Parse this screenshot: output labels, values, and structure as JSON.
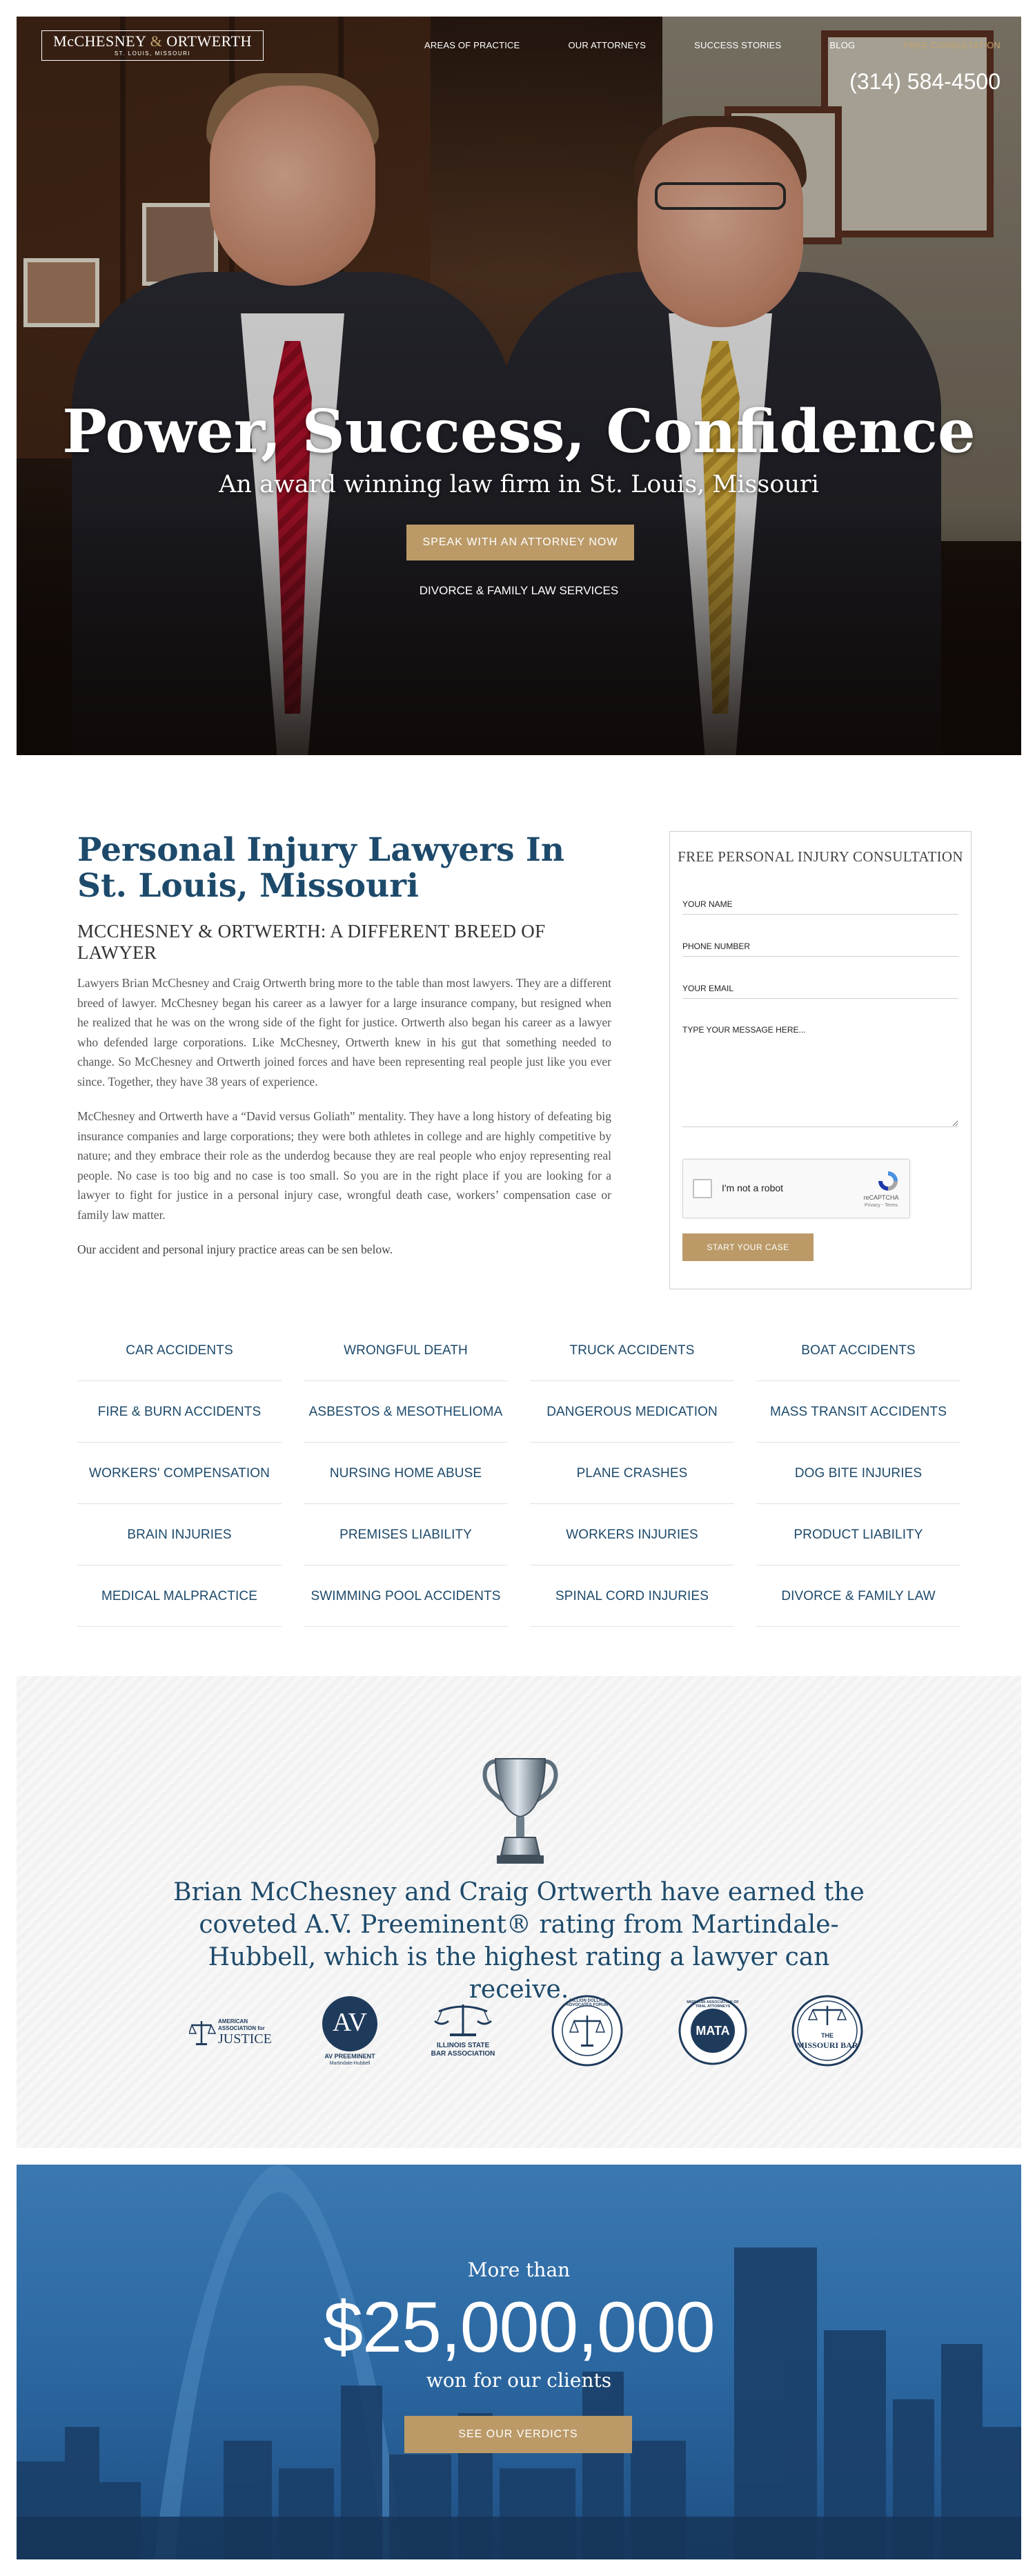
{
  "brand": {
    "logo_name_a": "McCHESNEY",
    "logo_amp": "&",
    "logo_name_b": "ORTWERTH",
    "logo_location": "ST. LOUIS, MISSOURI",
    "accent_color": "#bb9a68",
    "primary_color": "#1d4a6b"
  },
  "nav": {
    "items": [
      {
        "label": "AREAS OF PRACTICE"
      },
      {
        "label": "OUR ATTORNEYS"
      },
      {
        "label": "SUCCESS STORIES"
      },
      {
        "label": "BLOG"
      },
      {
        "label": "FREE CONSULTATION"
      }
    ],
    "phone": "(314) 584-4500"
  },
  "hero": {
    "title": "Power, Success, Confidence",
    "subtitle": "An award winning law firm in St. Louis, Missouri",
    "cta_label": "SPEAK WITH AN ATTORNEY NOW",
    "link_label": "DIVORCE & FAMILY LAW SERVICES"
  },
  "intro": {
    "heading": "Personal Injury Lawyers In St. Louis, Missouri",
    "subheading": "MCCHESNEY & ORTWERTH: A DIFFERENT BREED OF LAWYER",
    "paragraph_1": "Lawyers Brian McChesney and Craig Ortwerth bring more to the table than most lawyers. They are a different breed of lawyer. McChesney began his career as a lawyer for a large insurance company, but resigned when he realized that he was on the wrong side of the fight for justice. Ortwerth also began his career as a lawyer who defended large corporations. Like McChesney, Ortwerth knew in his gut that something needed to change. So McChesney and Ortwerth joined forces and have been representing real people just like you ever since. Together, they have 38 years of experience.",
    "paragraph_2": "McChesney and Ortwerth have a “David versus Goliath” mentality. They have a long history of defeating big insurance companies and large corporations; they were both athletes in college and are highly competitive by nature; and they embrace their role as the underdog because they are real people who enjoy representing real people. No case is too big and no case is too small. So you are in the right place if you are looking for a lawyer to fight for justice in a personal injury case, wrongful death case, workers’ compensation case or family law matter.",
    "paragraph_3": "Our accident and personal injury practice areas can be sen below."
  },
  "form": {
    "title": "FREE PERSONAL INJURY CONSULTATION",
    "name_placeholder": "YOUR NAME",
    "phone_placeholder": "PHONE NUMBER",
    "email_placeholder": "YOUR EMAIL",
    "message_placeholder": "TYPE YOUR MESSAGE HERE...",
    "recaptcha_label": "I'm not a robot",
    "recaptcha_brand": "reCAPTCHA",
    "recaptcha_terms": "Privacy - Terms",
    "submit_label": "START YOUR CASE"
  },
  "practice_areas": [
    "CAR ACCIDENTS",
    "WRONGFUL DEATH",
    "TRUCK ACCIDENTS",
    "BOAT ACCIDENTS",
    "FIRE & BURN ACCIDENTS",
    "ASBESTOS & MESOTHELIOMA",
    "DANGEROUS MEDICATION",
    "MASS TRANSIT ACCIDENTS",
    "WORKERS' COMPENSATION",
    "NURSING HOME ABUSE",
    "PLANE CRASHES",
    "DOG BITE INJURIES",
    "BRAIN INJURIES",
    "PREMISES LIABILITY",
    "WORKERS INJURIES",
    "PRODUCT LIABILITY",
    "MEDICAL MALPRACTICE",
    "SWIMMING POOL ACCIDENTS",
    "SPINAL CORD INJURIES",
    "DIVORCE & FAMILY LAW"
  ],
  "awards": {
    "text": "Brian McChesney and Craig Ortwerth have earned the coveted A.V. Preeminent® rating from Martindale-Hubbell, which is the highest rating a lawyer can receive.",
    "badges": {
      "aaj_line1": "AMERICAN",
      "aaj_line2": "ASSOCIATION for",
      "aaj_line3": "JUSTICE",
      "av_mark": "AV",
      "av_line1": "AV PREEMINENT",
      "av_line2": "Martindale-Hubbell",
      "isba_line1": "ILLINOIS STATE",
      "isba_line2": "BAR ASSOCIATION",
      "mdaf_text": "MILLION DOLLAR ADVOCATES FORUM",
      "mata_mark": "MATA",
      "mata_text": "MISSOURI ASSOCIATION OF TRIAL ATTORNEYS",
      "mobar_line1": "THE",
      "mobar_line2": "MISSOURI BAR"
    }
  },
  "verdicts": {
    "pre": "More than",
    "amount": "$25,000,000",
    "post": "won for our clients",
    "cta_label": "SEE OUR VERDICTS"
  }
}
